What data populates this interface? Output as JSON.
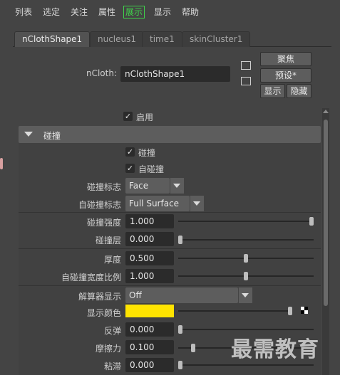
{
  "menu": [
    "列表",
    "选定",
    "关注",
    "属性",
    "展示",
    "显示",
    "帮助"
  ],
  "tabs": [
    "nClothShape1",
    "nucleus1",
    "time1",
    "skinCluster1"
  ],
  "node": {
    "label": "nCloth:",
    "value": "nClothShape1",
    "focus_button": "聚焦",
    "presets_button": "预设*",
    "show_button": "显示",
    "hide_button": "隐藏"
  },
  "enable_label": "启用",
  "section": {
    "title": "碰撞",
    "collide_label": "碰撞",
    "self_collide_label": "自碰撞",
    "collision_flag_label": "碰撞标志",
    "collision_flag_value": "Face",
    "self_collision_flag_label": "自碰撞标志",
    "self_collision_flag_value": "Full Surface",
    "collide_strength_label": "碰撞强度",
    "collide_strength_value": "1.000",
    "collision_layer_label": "碰撞层",
    "collision_layer_value": "0.000",
    "thickness_label": "厚度",
    "thickness_value": "0.500",
    "self_collide_width_label": "自碰撞宽度比例",
    "self_collide_width_value": "1.000",
    "solver_display_label": "解算器显示",
    "solver_display_value": "Off",
    "display_color_label": "显示颜色",
    "display_color": "#ffe400",
    "bounce_label": "反弹",
    "bounce_value": "0.000",
    "friction_label": "摩擦力",
    "friction_value": "0.100",
    "stickiness_label": "粘滞",
    "stickiness_value": "0.000"
  },
  "sliders": {
    "collide_strength": 1.0,
    "collision_layer": 0.0,
    "thickness": 0.5,
    "self_collide_width": 0.5,
    "display_color": 1.0,
    "bounce": 0.0,
    "friction": 0.1,
    "stickiness": 0.0
  },
  "watermark": "最需教育"
}
